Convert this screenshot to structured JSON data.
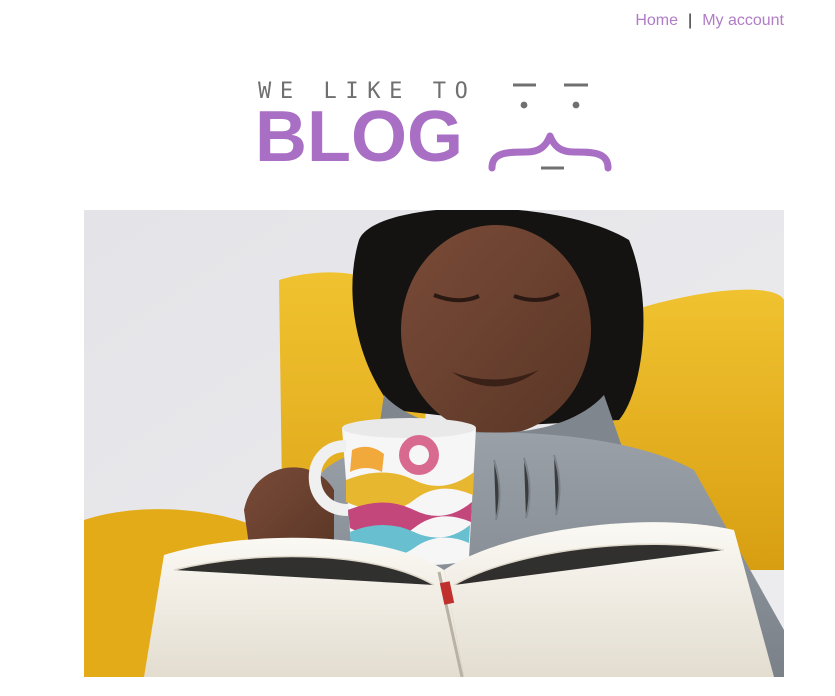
{
  "nav": {
    "home_label": "Home",
    "separator": "|",
    "account_label": "My account",
    "link_color": "#b07cc6"
  },
  "logo": {
    "tagline": "WE LIKE TO",
    "wordmark": "BLOG",
    "face_icon": "curly-brace-face-icon",
    "tagline_color": "#707070",
    "brand_color": "#a96fc4"
  },
  "hero": {
    "image_icon": "woman-reading-book-with-mug-photo",
    "colors": {
      "wall": "#e6e6ea",
      "sofa": "#e8b41c",
      "sweater": "#8f959c",
      "skin": "#6a4232",
      "book_pages": "#f4f1ea"
    }
  }
}
